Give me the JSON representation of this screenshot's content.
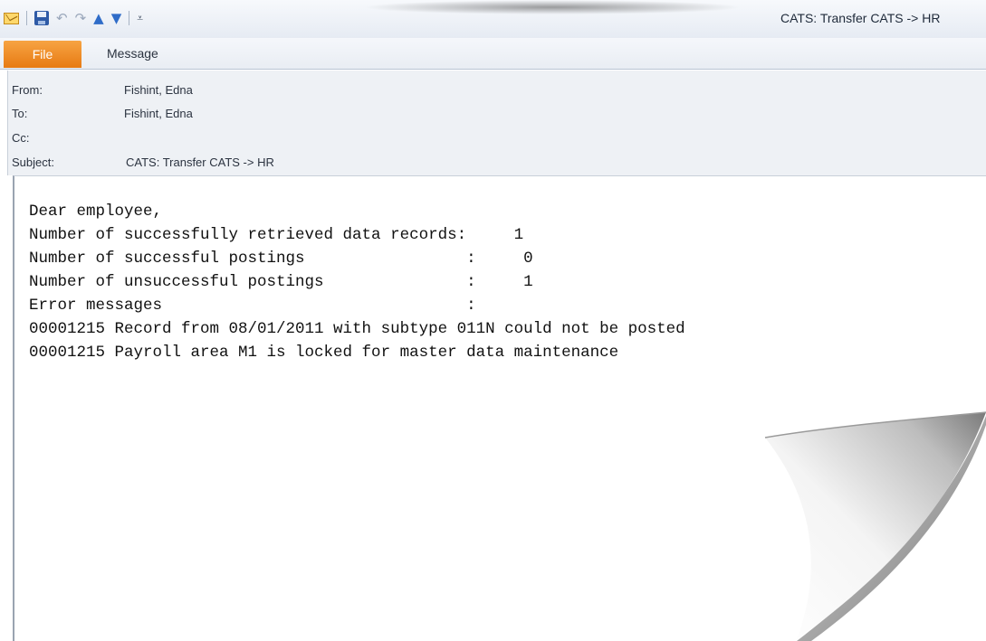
{
  "window": {
    "title": "CATS: Transfer CATS -> HR"
  },
  "quick_access": {
    "icons": [
      "mail-icon",
      "save-icon",
      "undo-icon",
      "redo-icon",
      "previous-item-icon",
      "next-item-icon",
      "customize-toolbar-icon"
    ]
  },
  "ribbon": {
    "tabs": [
      {
        "label": "File",
        "active": true,
        "color": "#e8801a"
      },
      {
        "label": "Message",
        "active": false
      }
    ]
  },
  "header": {
    "from_label": "From:",
    "from_value": "Fishint, Edna",
    "to_label": "To:",
    "to_value": "Fishint, Edna",
    "cc_label": "Cc:",
    "cc_value": "",
    "subject_label": "Subject:",
    "subject_value": "CATS: Transfer CATS -> HR"
  },
  "body": {
    "lines": [
      "Dear employee,",
      "Number of successfully retrieved data records:     1",
      "Number of successful postings                 :     0",
      "Number of unsuccessful postings               :     1",
      "Error messages                                :",
      "00001215 Record from 08/01/2011 with subtype 011N could not be posted",
      "00001215 Payroll area M1 is locked for master data maintenance"
    ]
  }
}
